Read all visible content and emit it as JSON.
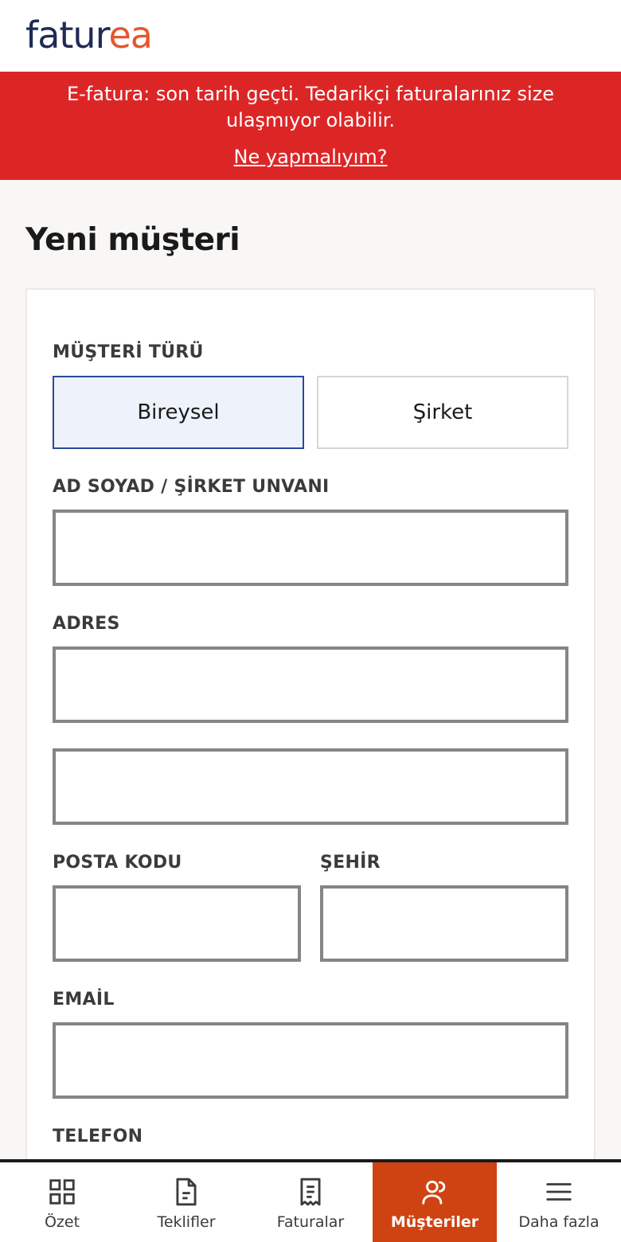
{
  "header": {
    "logo_part1": "fatur",
    "logo_part2": "ea"
  },
  "banner": {
    "message": "E-fatura: son tarih geçti. Tedarikçi faturalarınız size ulaşmıyor olabilir.",
    "link": "Ne yapmalıyım?"
  },
  "page": {
    "title": "Yeni müşteri"
  },
  "form": {
    "customer_type_label": "MÜŞTERİ TÜRÜ",
    "customer_type_options": [
      "Bireysel",
      "Şirket"
    ],
    "customer_type_selected": "Bireysel",
    "name_label": "AD SOYAD / ŞİRKET UNVANI",
    "name_value": "",
    "address_label": "ADRES",
    "address_line1_value": "",
    "address_line2_value": "",
    "postal_code_label": "POSTA KODU",
    "postal_code_value": "",
    "city_label": "ŞEHİR",
    "city_value": "",
    "email_label": "EMAİL",
    "email_value": "",
    "phone_label": "TELEFON"
  },
  "bottom_nav": {
    "items": [
      {
        "label": "Özet",
        "icon": "grid-icon",
        "active": false
      },
      {
        "label": "Teklifler",
        "icon": "document-icon",
        "active": false
      },
      {
        "label": "Faturalar",
        "icon": "receipt-icon",
        "active": false
      },
      {
        "label": "Müşteriler",
        "icon": "users-icon",
        "active": true
      },
      {
        "label": "Daha fazla",
        "icon": "menu-icon",
        "active": false
      }
    ]
  },
  "colors": {
    "brand_navy": "#1f2a55",
    "brand_orange": "#e4572e",
    "banner_red": "#dc2626",
    "nav_active": "#cf4312",
    "toggle_active_border": "#2b4a9a"
  }
}
